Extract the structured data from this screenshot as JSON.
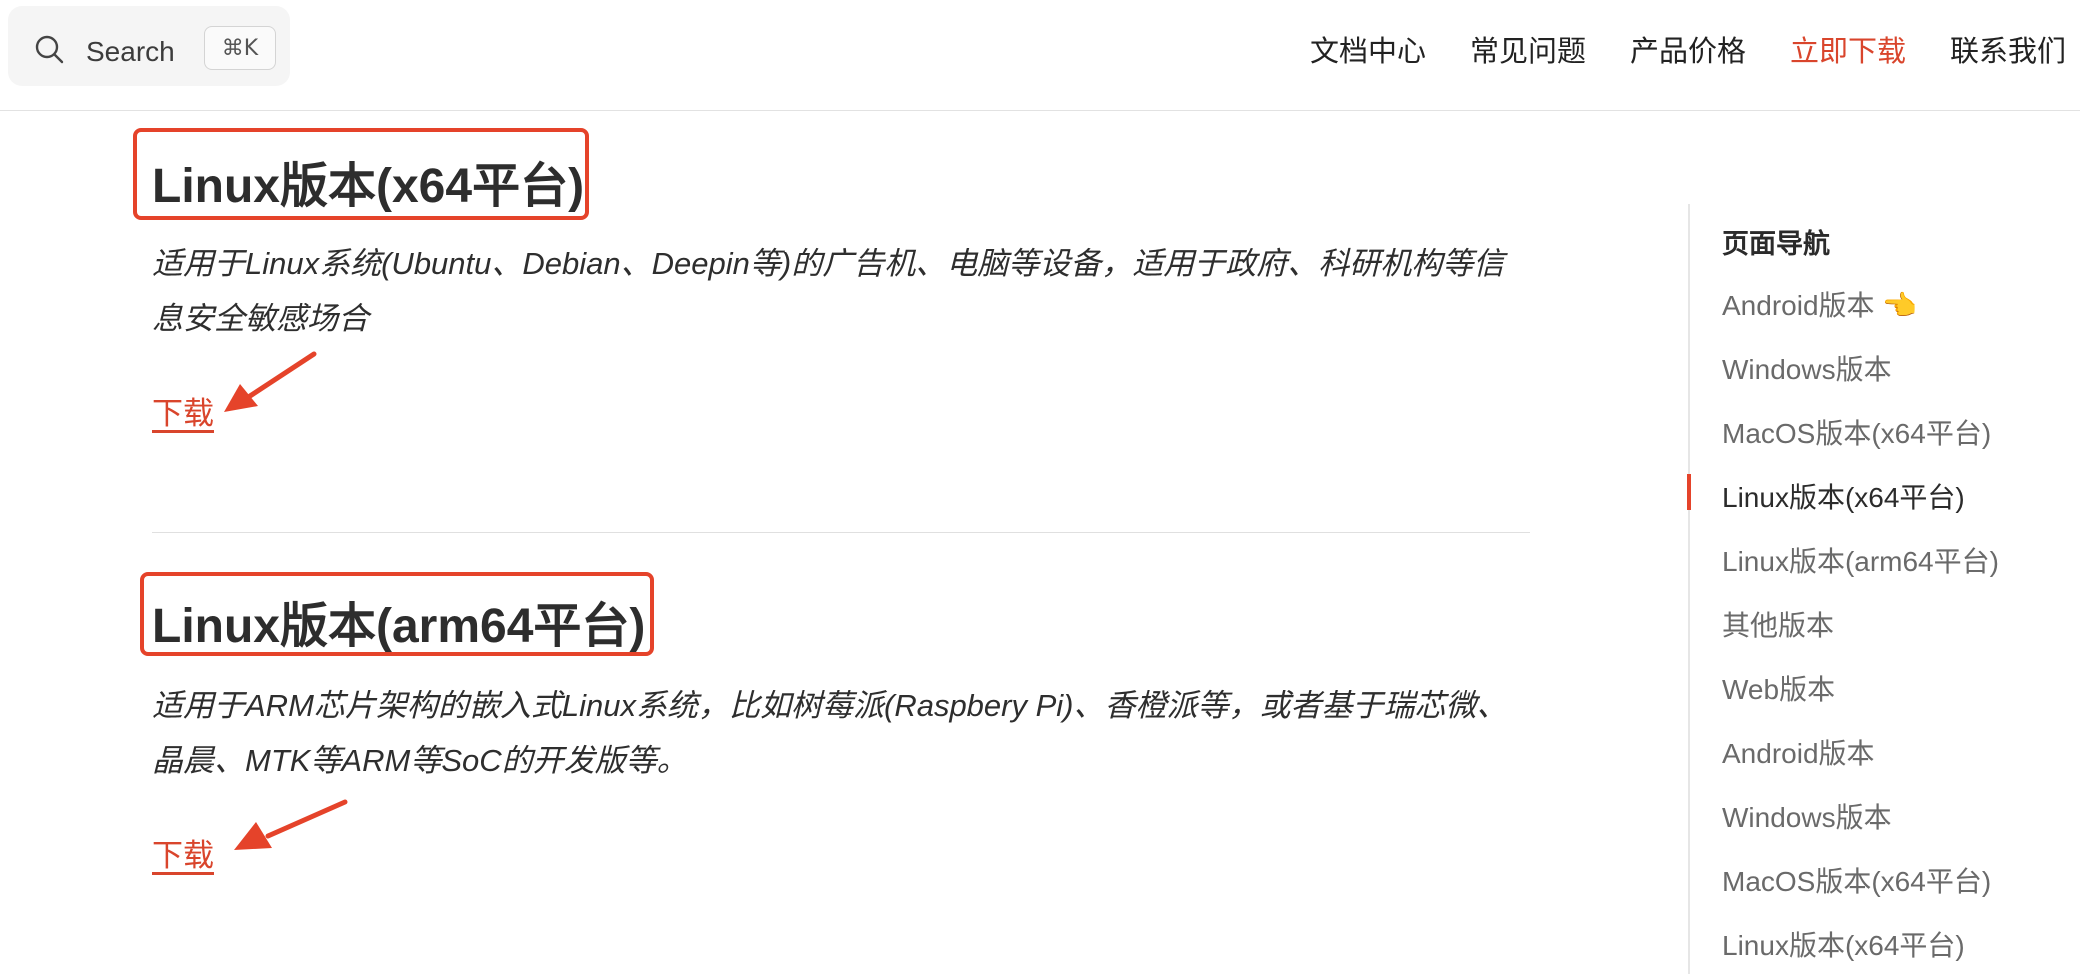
{
  "header": {
    "search": {
      "label": "Search",
      "shortcut": "⌘K"
    },
    "nav": [
      {
        "label": "文档中心"
      },
      {
        "label": "常见问题"
      },
      {
        "label": "产品价格"
      },
      {
        "label": "立即下载",
        "active": true
      },
      {
        "label": "联系我们"
      }
    ]
  },
  "main": {
    "sections": [
      {
        "title": "Linux版本(x64平台)",
        "description": "适用于Linux系统(Ubuntu、Debian、Deepin等)的广告机、电脑等设备，适用于政府、科研机构等信息安全敏感场合",
        "download_label": "下载"
      },
      {
        "title": "Linux版本(arm64平台)",
        "description": "适用于ARM芯片架构的嵌入式Linux系统，比如树莓派(Raspbery Pi)、香橙派等，或者基于瑞芯微、晶晨、MTK等ARM等SoC的开发版等。",
        "download_label": "下载"
      }
    ]
  },
  "toc": {
    "title": "页面导航",
    "items": [
      {
        "label": "Android版本 👈"
      },
      {
        "label": "Windows版本"
      },
      {
        "label": "MacOS版本(x64平台)"
      },
      {
        "label": "Linux版本(x64平台)",
        "current": true
      },
      {
        "label": "Linux版本(arm64平台)"
      },
      {
        "label": "其他版本"
      },
      {
        "label": "Web版本"
      },
      {
        "label": "Android版本"
      },
      {
        "label": "Windows版本"
      },
      {
        "label": "MacOS版本(x64平台)"
      },
      {
        "label": "Linux版本(x64平台)"
      }
    ]
  },
  "colors": {
    "accent": "#d9452c",
    "annotation": "#e5432a"
  },
  "icons": [
    "search-icon"
  ]
}
